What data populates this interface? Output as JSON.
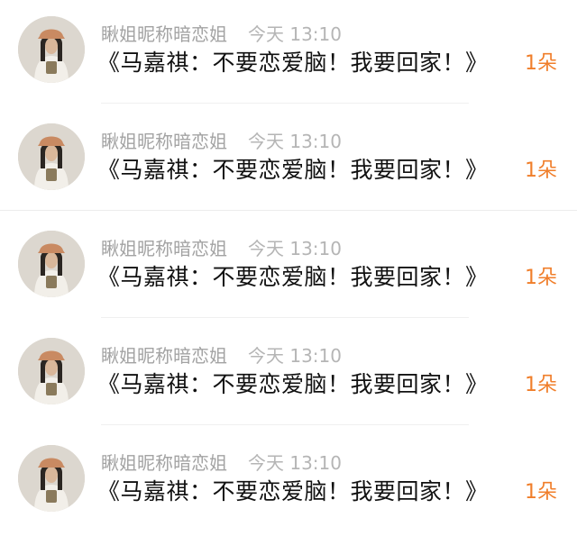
{
  "comments": [
    {
      "name": "瞅姐昵称暗恋姐",
      "time": "今天 13:10",
      "message": "《马嘉祺：不要恋爱脑！我要回家！》",
      "count": "1朵"
    },
    {
      "name": "瞅姐昵称暗恋姐",
      "time": "今天 13:10",
      "message": "《马嘉祺：不要恋爱脑！我要回家！》",
      "count": "1朵"
    },
    {
      "name": "瞅姐昵称暗恋姐",
      "time": "今天 13:10",
      "message": "《马嘉祺：不要恋爱脑！我要回家！》",
      "count": "1朵"
    },
    {
      "name": "瞅姐昵称暗恋姐",
      "time": "今天 13:10",
      "message": "《马嘉祺：不要恋爱脑！我要回家！》",
      "count": "1朵"
    },
    {
      "name": "瞅姐昵称暗恋姐",
      "time": "今天 13:10",
      "message": "《马嘉祺：不要恋爱脑！我要回家！》",
      "count": "1朵"
    }
  ],
  "colors": {
    "name": "#a3a3a3",
    "time": "#b5b5b5",
    "message": "#111111",
    "count": "#f07e2a"
  }
}
